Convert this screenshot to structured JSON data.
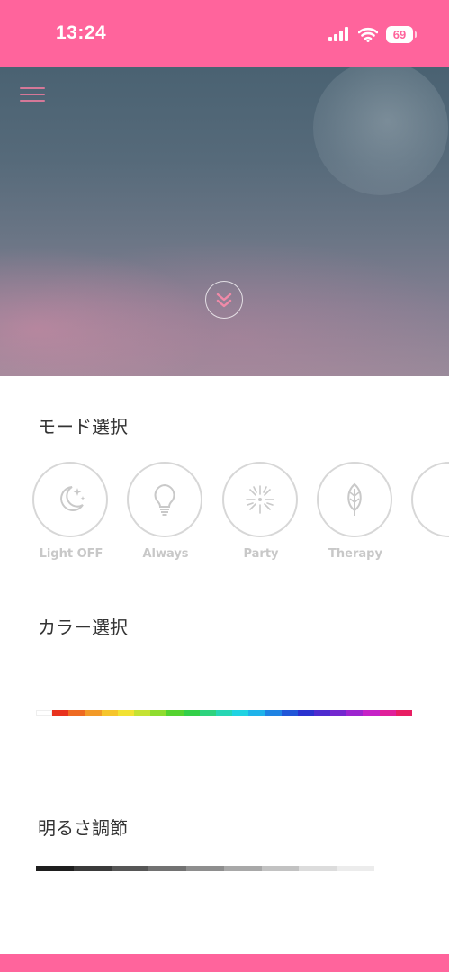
{
  "status_bar": {
    "time": "13:24",
    "battery": "69",
    "color": "#ff649c"
  },
  "hero": {
    "menu_icon": "hamburger-menu-icon",
    "expand_icon": "double-chevron-down-icon"
  },
  "mode_section": {
    "title": "モード選択",
    "modes": [
      {
        "label": "Light OFF",
        "icon": "moon-stars-icon"
      },
      {
        "label": "Always",
        "icon": "light-bulb-icon"
      },
      {
        "label": "Party",
        "icon": "firework-icon"
      },
      {
        "label": "Therapy",
        "icon": "leaf-icon"
      },
      {
        "label": "",
        "icon": "partial-mode-icon"
      }
    ]
  },
  "color_section": {
    "title": "カラー選択",
    "colors": [
      "#ffffff",
      "#e8321e",
      "#ee6a22",
      "#f29a28",
      "#f6c52c",
      "#f2e233",
      "#c5e233",
      "#8fdc2f",
      "#55d330",
      "#33cf49",
      "#2ed37e",
      "#27d6b4",
      "#20d3e2",
      "#1fb3ea",
      "#1f83e3",
      "#2156d8",
      "#2a32cf",
      "#4e2bcf",
      "#7428cf",
      "#9d25cf",
      "#c622c7",
      "#e0209a",
      "#e81e63"
    ]
  },
  "brightness_section": {
    "title": "明るさ調節",
    "levels": [
      "#1e1e1e",
      "#3a3a3a",
      "#565656",
      "#727272",
      "#8e8e8e",
      "#a8a8a8",
      "#c2c2c2",
      "#dcdcdc",
      "#ececec"
    ]
  },
  "footer": {
    "color": "#ff649c"
  }
}
